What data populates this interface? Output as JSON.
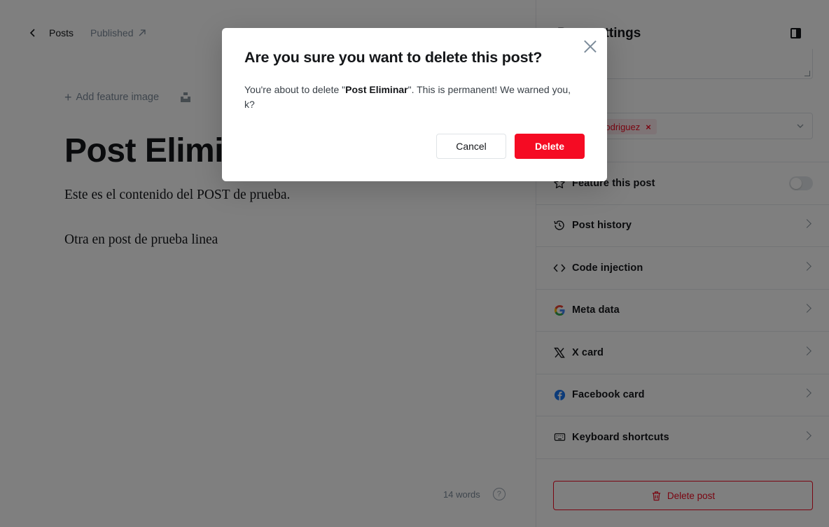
{
  "topbar": {
    "back_label": "Posts",
    "status_label": "Published"
  },
  "editor": {
    "add_feature_label": "Add feature image",
    "title": "Post Eliminar",
    "paragraphs": [
      "Este es el contenido del POST de prueba.",
      "Otra en post de prueba linea"
    ],
    "word_count": "14 words",
    "help_glyph": "?"
  },
  "settings": {
    "title": "Post settings",
    "author_tag": "Rodriguez",
    "author_remove": "×",
    "items": [
      {
        "label": "Feature this post",
        "icon": "star-icon"
      },
      {
        "label": "Post history",
        "icon": "history-icon"
      },
      {
        "label": "Code injection",
        "icon": "code-icon"
      },
      {
        "label": "Meta data",
        "icon": "google-icon"
      },
      {
        "label": "X card",
        "icon": "x-icon"
      },
      {
        "label": "Facebook card",
        "icon": "facebook-icon"
      },
      {
        "label": "Keyboard shortcuts",
        "icon": "keyboard-icon"
      }
    ],
    "feature_toggle_on": false,
    "delete_label": "Delete post"
  },
  "modal": {
    "title": "Are you sure you want to delete this post?",
    "text_before": "You're about to delete \"",
    "post_name": "Post Eliminar",
    "text_after": "\". This is permanent! We warned you, k?",
    "cancel_label": "Cancel",
    "delete_label": "Delete"
  },
  "colors": {
    "accent_red": "#f50b23",
    "overlay": "rgba(0,0,0,0.5)"
  }
}
